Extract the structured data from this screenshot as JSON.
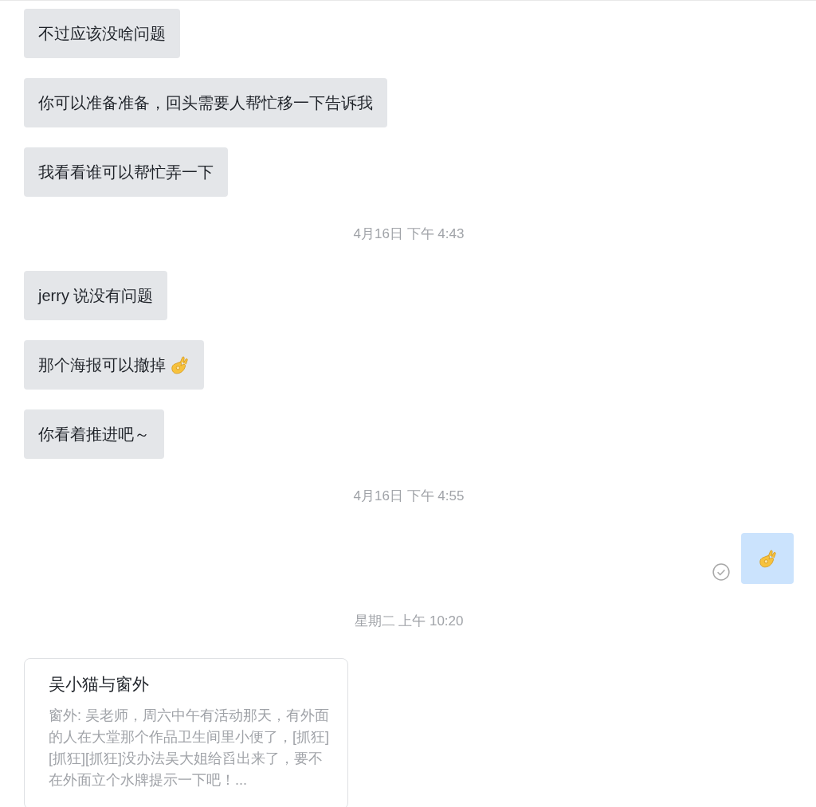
{
  "messages": [
    {
      "kind": "incoming",
      "text": "不过应该没啥问题"
    },
    {
      "kind": "incoming",
      "text": "你可以准备准备，回头需要人帮忙移一下告诉我"
    },
    {
      "kind": "incoming",
      "text": "我看看谁可以帮忙弄一下"
    },
    {
      "kind": "timestamp",
      "text": "4月16日 下午 4:43"
    },
    {
      "kind": "incoming",
      "text": "jerry 说没有问题"
    },
    {
      "kind": "incoming",
      "text": "那个海报可以撤掉",
      "ok_hand": true
    },
    {
      "kind": "incoming",
      "text": "你看着推进吧～"
    },
    {
      "kind": "timestamp",
      "text": "4月16日 下午 4:55"
    },
    {
      "kind": "outgoing",
      "ok_hand": true,
      "read": true
    },
    {
      "kind": "timestamp",
      "text": "星期二 上午 10:20"
    },
    {
      "kind": "card",
      "title": "吴小猫与窗外",
      "body": "窗外: 吴老师，周六中午有活动那天，有外面的人在大堂那个作品卫生间里小便了，[抓狂][抓狂][抓狂]没办法吴大姐给舀出来了，要不在外面立个水牌提示一下吧！..."
    }
  ]
}
